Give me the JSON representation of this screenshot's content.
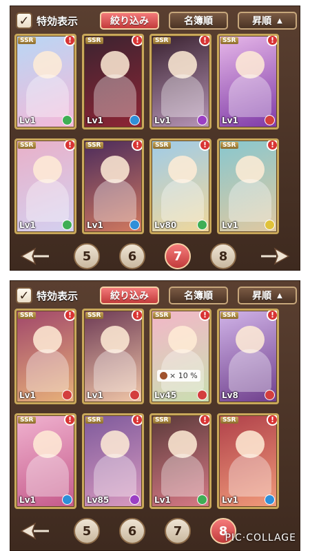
{
  "panels": [
    {
      "toolbar": {
        "special_display": "特効表示",
        "filter": "絞り込み",
        "sort": "名簿順",
        "order": "昇順",
        "order_arrow": "▲",
        "check": "✓"
      },
      "cards": [
        {
          "rarity": "SSR",
          "level": "Lv1",
          "alert": "!",
          "bg": [
            "#b8d7f5",
            "#f4b8d8"
          ],
          "attr_color": "#3fae55"
        },
        {
          "rarity": "SSR",
          "level": "Lv1",
          "alert": "!",
          "bg": [
            "#3b2430",
            "#8e2535"
          ],
          "attr_color": "#2f8fd8"
        },
        {
          "rarity": "SSR",
          "level": "Lv1",
          "alert": "!",
          "bg": [
            "#3a2230",
            "#b796b7"
          ],
          "attr_color": "#9b3fc4"
        },
        {
          "rarity": "SSR",
          "level": "Lv1",
          "alert": "!",
          "bg": [
            "#e7b8e9",
            "#7e3aa6"
          ],
          "attr_color": "#d33e3e"
        },
        {
          "rarity": "SSR",
          "level": "Lv1",
          "alert": "!",
          "bg": [
            "#e9b0c8",
            "#d3d0f0"
          ],
          "attr_color": "#3fae55"
        },
        {
          "rarity": "SSR",
          "level": "Lv1",
          "alert": "!",
          "bg": [
            "#4b2b5c",
            "#d27a5f"
          ],
          "attr_color": "#2f8fd8"
        },
        {
          "rarity": "SSR",
          "level": "Lv80",
          "alert": "!",
          "bg": [
            "#9fcbe8",
            "#f0d79a"
          ],
          "attr_color": "#3fae55"
        },
        {
          "rarity": "SSR",
          "level": "Lv1",
          "alert": "!",
          "bg": [
            "#87c7cf",
            "#e0c8a0"
          ],
          "attr_color": "#e0c23a"
        }
      ],
      "pages": [
        "5",
        "6",
        "7",
        "8"
      ],
      "active_page": "7"
    },
    {
      "toolbar": {
        "special_display": "特効表示",
        "filter": "絞り込み",
        "sort": "名簿順",
        "order": "昇順",
        "order_arrow": "▲",
        "check": "✓"
      },
      "cards": [
        {
          "rarity": "SSR",
          "level": "Lv1",
          "alert": "!",
          "bg": [
            "#a0466a",
            "#e8b27a"
          ],
          "attr_color": "#d33e3e"
        },
        {
          "rarity": "SSR",
          "level": "Lv1",
          "alert": "!",
          "bg": [
            "#6d3a55",
            "#f1c7a8"
          ],
          "attr_color": "#d33e3e"
        },
        {
          "rarity": "SSR",
          "level": "Lv45",
          "alert": "!",
          "bg": [
            "#f3b6c8",
            "#c9dfb0"
          ],
          "attr_color": "#d33e3e",
          "bonus": "× 10 %"
        },
        {
          "rarity": "SSR",
          "level": "Lv8",
          "alert": "!",
          "bg": [
            "#d1b4e8",
            "#6f3f8c"
          ],
          "attr_color": "#d33e3e"
        },
        {
          "rarity": "SSR",
          "level": "Lv1",
          "alert": "!",
          "bg": [
            "#f0b3d0",
            "#c55a8a"
          ],
          "attr_color": "#2f8fd8"
        },
        {
          "rarity": "SSR",
          "level": "Lv85",
          "alert": "!",
          "bg": [
            "#7e5a9c",
            "#d89abf"
          ],
          "attr_color": "#9b3fc4"
        },
        {
          "rarity": "SSR",
          "level": "Lv1",
          "alert": "!",
          "bg": [
            "#5b3a3a",
            "#d77a86"
          ],
          "attr_color": "#3fae55"
        },
        {
          "rarity": "SSR",
          "level": "Lv1",
          "alert": "!",
          "bg": [
            "#b0414a",
            "#f09a7a"
          ],
          "attr_color": "#2f8fd8"
        }
      ],
      "pages": [
        "5",
        "6",
        "7",
        "8"
      ],
      "active_page": "8"
    }
  ],
  "watermark": "PIC·COLLAGE"
}
